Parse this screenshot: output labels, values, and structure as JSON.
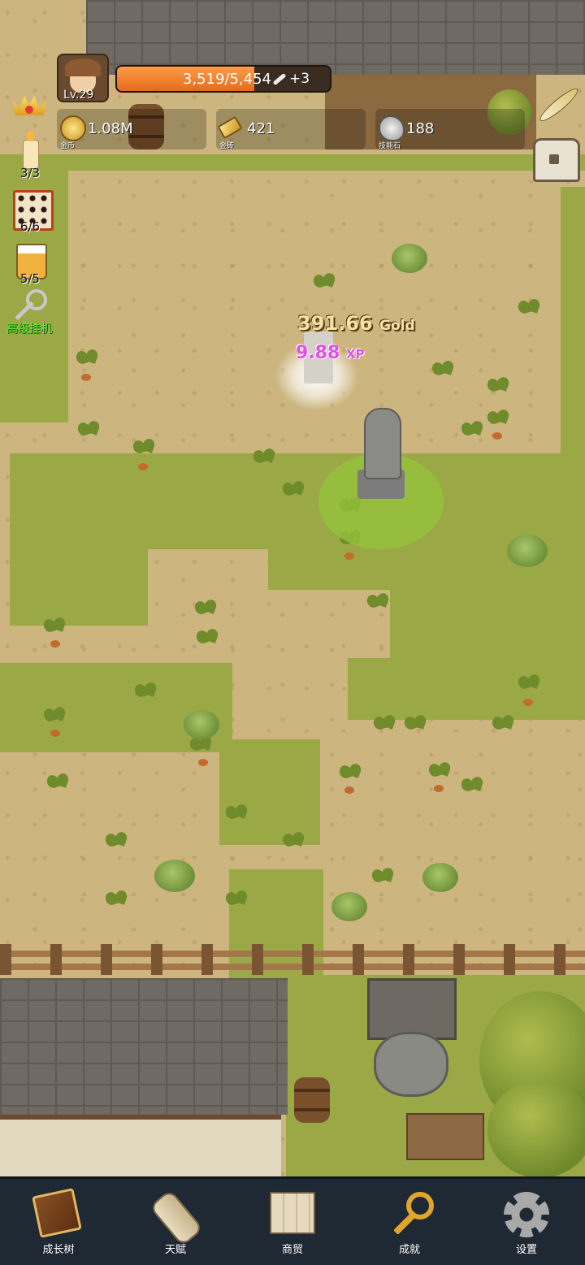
{
  "hud": {
    "level": "Lv.29",
    "xp_text": "3,519/5,454",
    "xp_fraction": 0.645,
    "xp_bonus": "+3",
    "resources": [
      {
        "icon": "gold-coin-icon",
        "value": "1.08M",
        "label": "金币"
      },
      {
        "icon": "gold-bar-icon",
        "value": "421",
        "label": "金砖"
      },
      {
        "icon": "skill-stone-icon",
        "value": "188",
        "label": "技能石"
      }
    ]
  },
  "side_items": [
    {
      "name": "crown-icon"
    },
    {
      "name": "candle-icon",
      "count": "3/3"
    },
    {
      "name": "dice-icon",
      "count": "6/6"
    },
    {
      "name": "beer-icon",
      "count": "5/5"
    },
    {
      "name": "auto-idle-key-icon",
      "label": "高级挂机"
    }
  ],
  "floating": {
    "gold_value": "391.66",
    "gold_unit": "Gold",
    "xp_value": "9.88",
    "xp_unit": "XP"
  },
  "nav": [
    {
      "icon": "book-icon",
      "label": "成长树"
    },
    {
      "icon": "scroll-icon",
      "label": "天赋"
    },
    {
      "icon": "map-icon",
      "label": "商贸"
    },
    {
      "icon": "key-icon",
      "label": "成就"
    },
    {
      "icon": "gear-icon",
      "label": "设置"
    }
  ],
  "colors": {
    "xp_bar": "#e46c1a",
    "grass": "#9aa946",
    "dirt": "#ccb57e",
    "nav_bg": "#1f2933",
    "auto_label": "#4cff2a",
    "xp_float": "#e04fe8"
  }
}
